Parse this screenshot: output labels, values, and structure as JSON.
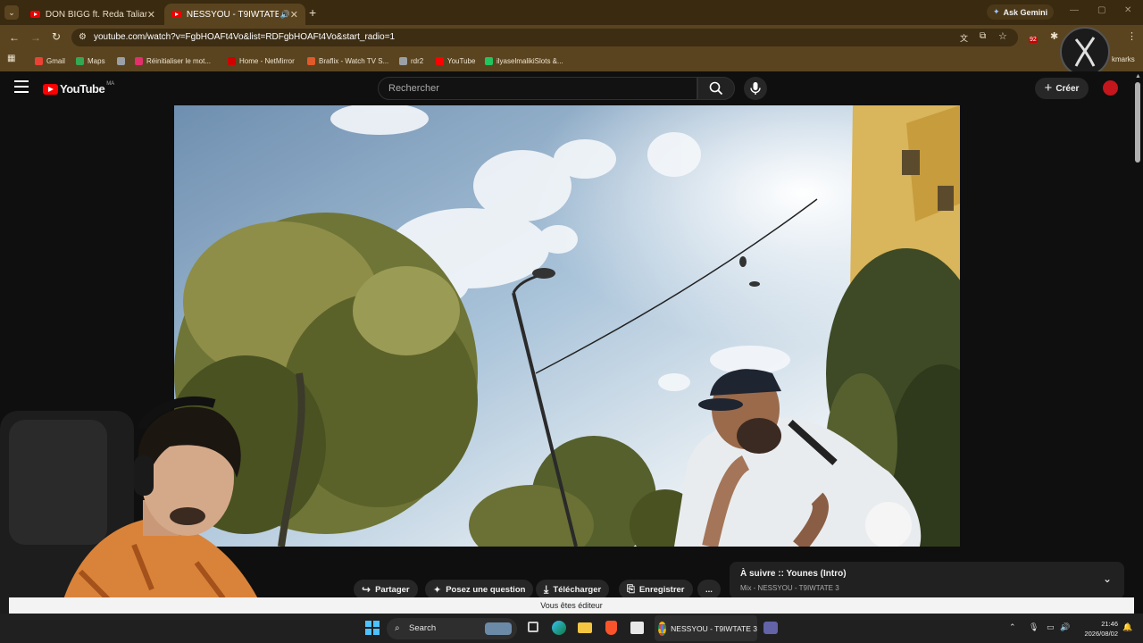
{
  "browser": {
    "tabs": [
      {
        "label": "DON BIGG ft. Reda Taliani - L'é",
        "active": false
      },
      {
        "label": "NESSYOU - T9IWTATE 3 - Yo",
        "active": true
      }
    ],
    "ask_gemini": "Ask Gemini",
    "url": "youtube.com/watch?v=FgbHOAFt4Vo&list=RDFgbHOAFt4Vo&start_radio=1",
    "ext_badge": "92",
    "bookmarks": [
      {
        "label": "Gmail",
        "color": "#ea4335"
      },
      {
        "label": "Maps",
        "color": "#34a853"
      },
      {
        "label": "",
        "color": "#9aa0a6"
      },
      {
        "label": "Réinitialiser le mot...",
        "color": "#e1306c"
      },
      {
        "label": "Home - NetMirror",
        "color": "#d00000"
      },
      {
        "label": "Braflix - Watch TV S...",
        "color": "#e05a2a"
      },
      {
        "label": "rdr2",
        "color": "#9aa0a6"
      },
      {
        "label": "YouTube",
        "color": "#ff0000"
      },
      {
        "label": "ilyaselmalikiSlots &...",
        "color": "#22c55e"
      }
    ],
    "bookmarks_overflow": "kmarks"
  },
  "youtube": {
    "logo_text": "YouTube",
    "region": "MA",
    "search_placeholder": "Rechercher",
    "create_label": "Créer",
    "actions": {
      "share": "Partager",
      "ask": "Posez une question",
      "download": "Télécharger",
      "save": "Enregistrer",
      "more": "..."
    },
    "up_next": {
      "title": "À suivre :: Younes (Intro)",
      "subtitle": "Mix - NESSYOU - T9IWTATE 3"
    },
    "editor_notice": "Vous êtes éditeur"
  },
  "taskbar": {
    "search_label": "Search",
    "active_app": "NESSYOU - T9IWTATE 3",
    "time": "21:46",
    "date": "2026/08/02"
  }
}
